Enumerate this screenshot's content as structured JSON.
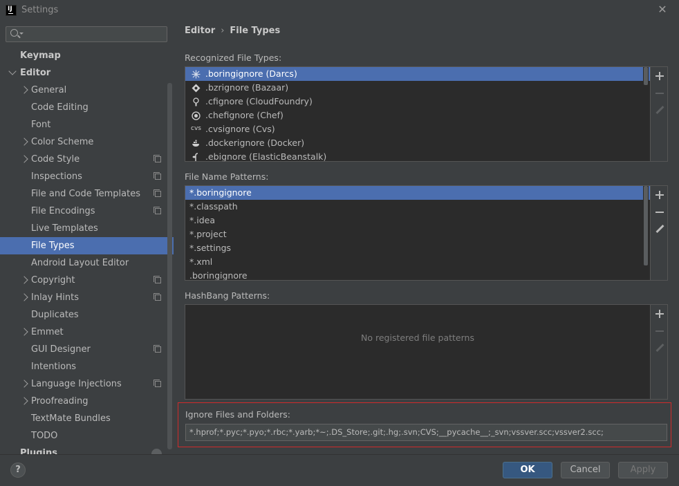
{
  "window": {
    "title": "Settings",
    "icon": "intellij-logo",
    "icon_text": "IJ"
  },
  "search": {
    "placeholder": "",
    "value": ""
  },
  "sidebar": {
    "items": [
      {
        "label": "Keymap",
        "level": 0,
        "bold": true,
        "arrow": "",
        "copy": false,
        "selected": false
      },
      {
        "label": "Editor",
        "level": 0,
        "bold": true,
        "arrow": "down",
        "copy": false,
        "selected": false
      },
      {
        "label": "General",
        "level": 1,
        "bold": false,
        "arrow": "right",
        "copy": false,
        "selected": false
      },
      {
        "label": "Code Editing",
        "level": 1,
        "bold": false,
        "arrow": "",
        "copy": false,
        "selected": false
      },
      {
        "label": "Font",
        "level": 1,
        "bold": false,
        "arrow": "",
        "copy": false,
        "selected": false
      },
      {
        "label": "Color Scheme",
        "level": 1,
        "bold": false,
        "arrow": "right",
        "copy": false,
        "selected": false
      },
      {
        "label": "Code Style",
        "level": 1,
        "bold": false,
        "arrow": "right",
        "copy": true,
        "selected": false
      },
      {
        "label": "Inspections",
        "level": 1,
        "bold": false,
        "arrow": "",
        "copy": true,
        "selected": false
      },
      {
        "label": "File and Code Templates",
        "level": 1,
        "bold": false,
        "arrow": "",
        "copy": true,
        "selected": false
      },
      {
        "label": "File Encodings",
        "level": 1,
        "bold": false,
        "arrow": "",
        "copy": true,
        "selected": false
      },
      {
        "label": "Live Templates",
        "level": 1,
        "bold": false,
        "arrow": "",
        "copy": false,
        "selected": false
      },
      {
        "label": "File Types",
        "level": 1,
        "bold": false,
        "arrow": "",
        "copy": false,
        "selected": true
      },
      {
        "label": "Android Layout Editor",
        "level": 1,
        "bold": false,
        "arrow": "",
        "copy": false,
        "selected": false
      },
      {
        "label": "Copyright",
        "level": 1,
        "bold": false,
        "arrow": "right",
        "copy": true,
        "selected": false
      },
      {
        "label": "Inlay Hints",
        "level": 1,
        "bold": false,
        "arrow": "right",
        "copy": true,
        "selected": false
      },
      {
        "label": "Duplicates",
        "level": 1,
        "bold": false,
        "arrow": "",
        "copy": false,
        "selected": false
      },
      {
        "label": "Emmet",
        "level": 1,
        "bold": false,
        "arrow": "right",
        "copy": false,
        "selected": false
      },
      {
        "label": "GUI Designer",
        "level": 1,
        "bold": false,
        "arrow": "",
        "copy": true,
        "selected": false
      },
      {
        "label": "Intentions",
        "level": 1,
        "bold": false,
        "arrow": "",
        "copy": false,
        "selected": false
      },
      {
        "label": "Language Injections",
        "level": 1,
        "bold": false,
        "arrow": "right",
        "copy": true,
        "selected": false
      },
      {
        "label": "Proofreading",
        "level": 1,
        "bold": false,
        "arrow": "right",
        "copy": false,
        "selected": false
      },
      {
        "label": "TextMate Bundles",
        "level": 1,
        "bold": false,
        "arrow": "",
        "copy": false,
        "selected": false
      },
      {
        "label": "TODO",
        "level": 1,
        "bold": false,
        "arrow": "",
        "copy": false,
        "selected": false
      },
      {
        "label": "Plugins",
        "level": 0,
        "bold": true,
        "arrow": "",
        "copy": false,
        "selected": false
      }
    ]
  },
  "breadcrumb": {
    "parent": "Editor",
    "separator": "›",
    "current": "File Types"
  },
  "recognized": {
    "label": "Recognized File Types:",
    "items": [
      {
        "text": ".boringignore (Darcs)",
        "icon": "darcs-icon",
        "selected": true
      },
      {
        "text": ".bzrignore (Bazaar)",
        "icon": "bazaar-icon",
        "selected": false
      },
      {
        "text": ".cfignore (CloudFoundry)",
        "icon": "cloudfoundry-icon",
        "selected": false
      },
      {
        "text": ".chefignore (Chef)",
        "icon": "chef-icon",
        "selected": false
      },
      {
        "text": ".cvsignore (Cvs)",
        "icon": "cvs-icon",
        "icon_text": "cvs",
        "selected": false
      },
      {
        "text": ".dockerignore (Docker)",
        "icon": "docker-icon",
        "selected": false
      },
      {
        "text": ".ebignore (ElasticBeanstalk)",
        "icon": "elasticbeanstalk-icon",
        "selected": false
      }
    ]
  },
  "patterns": {
    "label": "File Name Patterns:",
    "items": [
      {
        "text": "*.boringignore",
        "selected": true
      },
      {
        "text": "*.classpath",
        "selected": false
      },
      {
        "text": "*.idea",
        "selected": false
      },
      {
        "text": "*.project",
        "selected": false
      },
      {
        "text": "*.settings",
        "selected": false
      },
      {
        "text": "*.xml",
        "selected": false
      },
      {
        "text": ".boringignore",
        "selected": false
      }
    ]
  },
  "hashbang": {
    "label": "HashBang Patterns:",
    "empty_text": "No registered file patterns"
  },
  "ignore": {
    "label": "Ignore Files and Folders:",
    "value": "*.hprof;*.pyc;*.pyo;*.rbc;*.yarb;*~;.DS_Store;.git;.hg;.svn;CVS;__pycache__;_svn;vssver.scc;vssver2.scc;"
  },
  "footer": {
    "help": "?",
    "ok": "OK",
    "cancel": "Cancel",
    "apply": "Apply"
  },
  "colors": {
    "selection": "#4b6eaf",
    "ok_button": "#365880",
    "highlight_border": "#d02b2b"
  }
}
